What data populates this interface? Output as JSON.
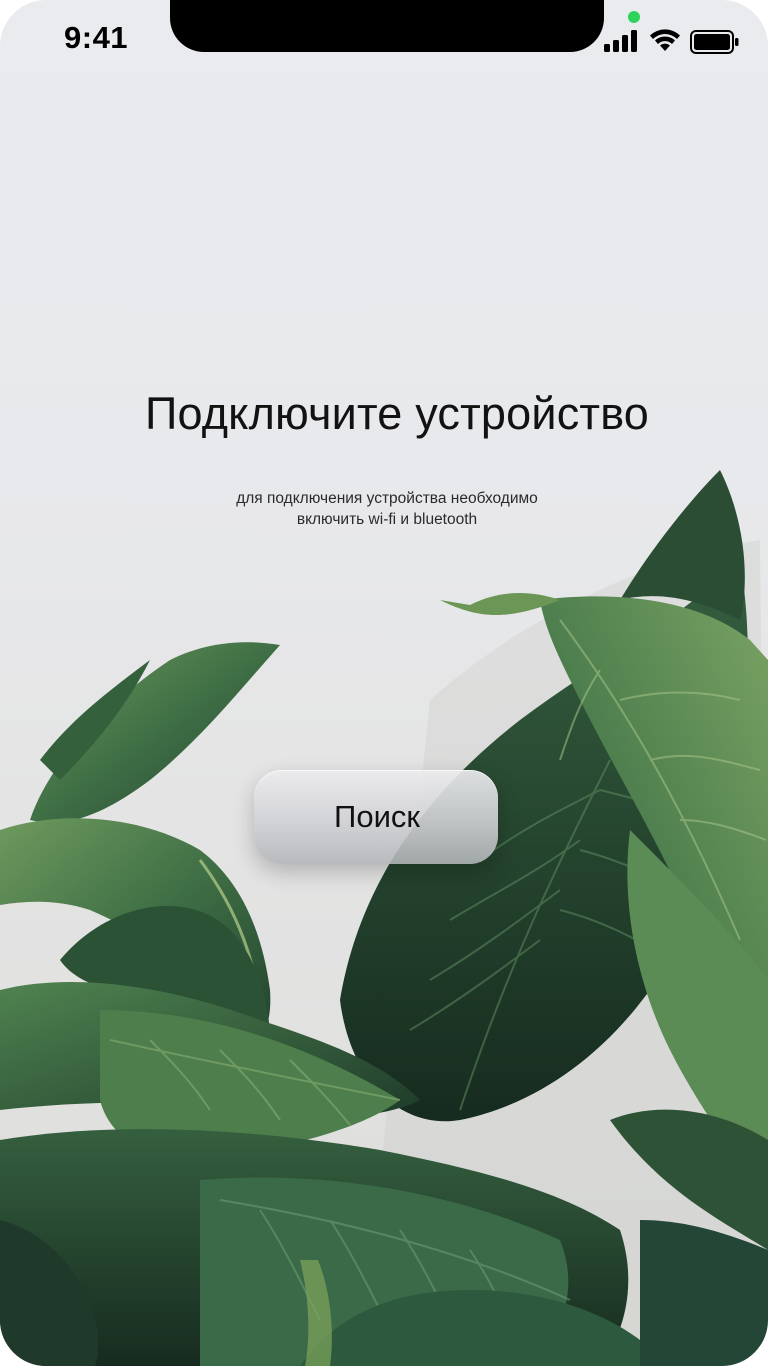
{
  "status_bar": {
    "time": "9:41",
    "icons": [
      "signal-icon",
      "wifi-icon",
      "battery-icon"
    ],
    "camera_indicator_color": "#2ed35a"
  },
  "main": {
    "title": "Подключите устройство",
    "subtitle_line1": "для подключения устройства необходимо",
    "subtitle_line2": "включить wi-fi и bluetooth",
    "search_button_label": "Поиск"
  },
  "background": {
    "image": "plant-leaves",
    "leaf_colors": [
      "#2f5a3a",
      "#3e7046",
      "#5e8f4c",
      "#1f3a2a"
    ],
    "wall_color": "#e8e9ec"
  }
}
